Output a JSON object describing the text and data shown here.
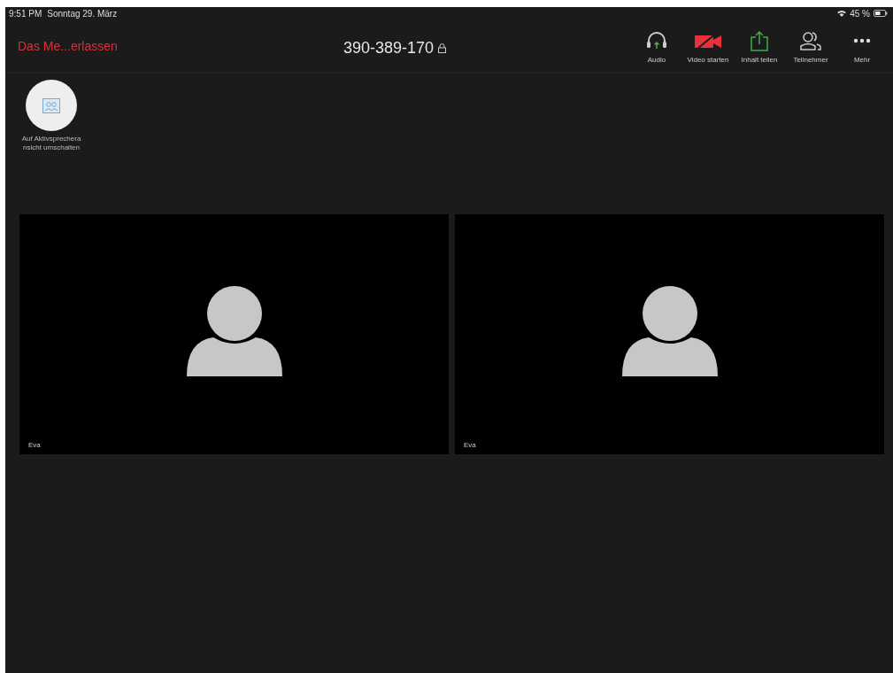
{
  "status_bar": {
    "time": "9:51 PM",
    "date": "Sonntag 29. März",
    "battery": "45 %"
  },
  "top_bar": {
    "leave": "Das Me...erlassen",
    "meeting_id": "390-389-170"
  },
  "toolbar": [
    {
      "kind": "audio",
      "label": "Audio"
    },
    {
      "kind": "video",
      "label": "Video starten"
    },
    {
      "kind": "share",
      "label": "Inhalt teilen"
    },
    {
      "kind": "participants",
      "label": "Teilnehmer"
    },
    {
      "kind": "more",
      "label": "Mehr"
    }
  ],
  "view_switch": {
    "label": "Auf Aktivsprecheransicht umschalten"
  },
  "tiles": [
    {
      "name": "Eva"
    },
    {
      "name": "Eva"
    }
  ]
}
